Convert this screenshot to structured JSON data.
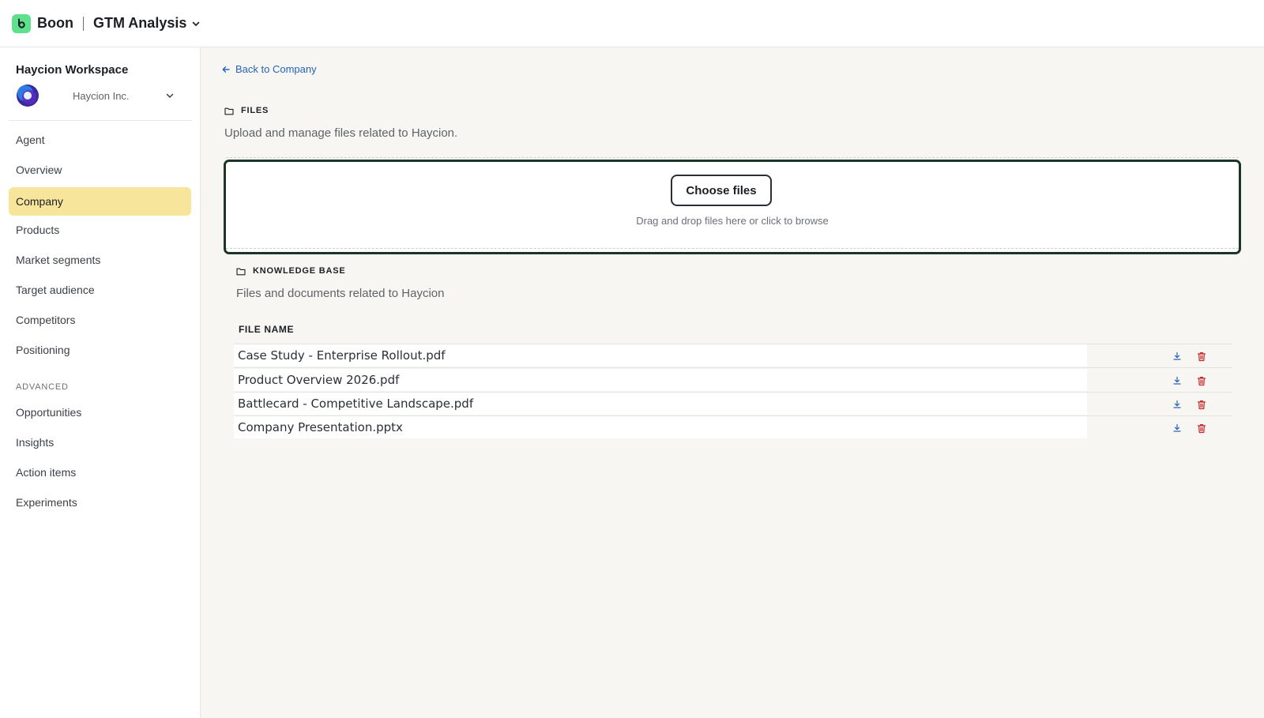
{
  "app": {
    "brand": "Boon",
    "project": "GTM Analysis",
    "icons": {
      "brand": "boon-logo-icon",
      "project_menu": "chevron-down-icon"
    },
    "colors": {
      "brand_green": "#5ee08c"
    }
  },
  "sidebar": {
    "workspace_title": "Haycion Workspace",
    "company": "Haycion Inc.",
    "items": [
      {
        "label": "Agent",
        "active": false
      },
      {
        "label": "Overview",
        "active": false
      },
      {
        "label": "Company",
        "active": true
      },
      {
        "label": "Products",
        "active": false
      },
      {
        "label": "Market segments",
        "active": false
      },
      {
        "label": "Target audience",
        "active": false
      },
      {
        "label": "Competitors",
        "active": false
      },
      {
        "label": "Positioning",
        "active": false
      }
    ],
    "advanced_label": "ADVANCED",
    "advanced_items": [
      {
        "label": "Opportunities"
      },
      {
        "label": "Insights"
      },
      {
        "label": "Action items"
      },
      {
        "label": "Experiments"
      }
    ],
    "colors": {
      "active_bg": "#f7e59b"
    }
  },
  "main": {
    "back_link": "Back to Company",
    "files": {
      "heading": "FILES",
      "subtitle": "Upload and manage files related to Haycion.",
      "choose_button": "Choose files",
      "drop_hint": "Drag and drop files here or click to browse"
    },
    "knowledge_base": {
      "heading": "KNOWLEDGE BASE",
      "subtitle": "Files and documents related to Haycion",
      "column_header": "FILE NAME",
      "rows": [
        {
          "name": "Case Study - Enterprise Rollout.pdf"
        },
        {
          "name": "Product Overview 2026.pdf"
        },
        {
          "name": "Battlecard - Competitive Landscape.pdf"
        },
        {
          "name": "Company Presentation.pptx"
        }
      ],
      "icons": {
        "download": "download-icon",
        "delete": "trash-icon"
      },
      "colors": {
        "download": "#2563b8",
        "delete": "#c62828"
      }
    }
  }
}
